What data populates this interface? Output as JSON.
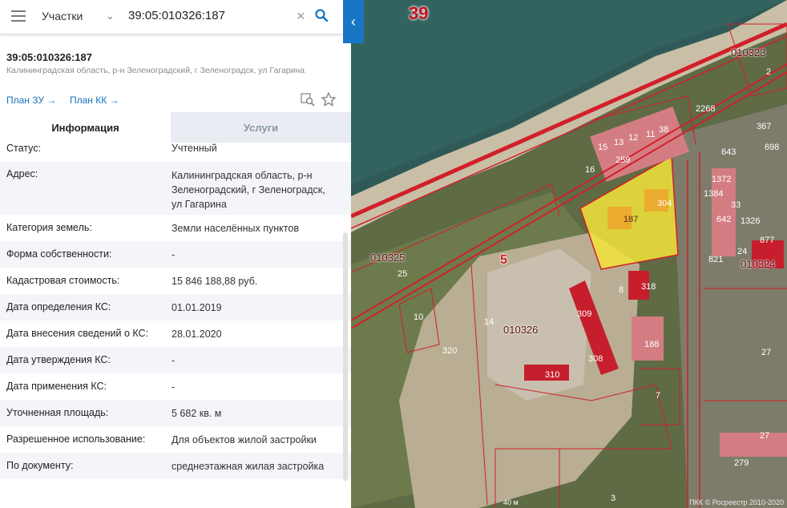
{
  "search": {
    "type_label": "Участки",
    "query": "39:05:010326:187"
  },
  "card": {
    "cadastral_number": "39:05:010326:187",
    "address_short": "Калининградская область, р-н Зеленоградский, г Зеленоградск, ул Гагарина",
    "plan_zu": "План ЗУ →",
    "plan_kk": "План КК →"
  },
  "tabs": {
    "info": "Информация",
    "services": "Услуги"
  },
  "rows": [
    {
      "label": "Статус:",
      "value": "Учтенный"
    },
    {
      "label": "Адрес:",
      "value": "Калининградская область, р-н Зеленоградский, г Зеленоградск, ул Гагарина"
    },
    {
      "label": "Категория земель:",
      "value": "Земли населённых пунктов"
    },
    {
      "label": "Форма собственности:",
      "value": "-"
    },
    {
      "label": "Кадастровая стоимость:",
      "value": "15 846 188,88 руб."
    },
    {
      "label": "Дата определения КС:",
      "value": "01.01.2019"
    },
    {
      "label": "Дата внесения сведений о КС:",
      "value": "28.01.2020"
    },
    {
      "label": "Дата утверждения КС:",
      "value": "-"
    },
    {
      "label": "Дата применения КС:",
      "value": "-"
    },
    {
      "label": "Уточненная площадь:",
      "value": "5 682 кв. м"
    },
    {
      "label": "Разрешенное использование:",
      "value": "Для объектов жилой застройки"
    },
    {
      "label": "По документу:",
      "value": "среднеэтажная жилая застройка"
    }
  ],
  "map": {
    "region": "39",
    "quarters": [
      "010323",
      "010325",
      "010326",
      "010324"
    ],
    "district": "5",
    "highlight_parcel": "187",
    "parcel_labels": [
      "304",
      "2268",
      "38",
      "11",
      "12",
      "13",
      "15",
      "259",
      "16",
      "643",
      "698",
      "367",
      "1372",
      "1384",
      "33",
      "642",
      "1326",
      "821",
      "24",
      "877",
      "25",
      "10",
      "14",
      "320",
      "309",
      "308",
      "310",
      "8",
      "318",
      "188",
      "7",
      "27",
      "27",
      "279",
      "3",
      "2"
    ],
    "scale": "40 м",
    "copyright": "ПКК © Росреестр 2010-2020"
  },
  "colors": {
    "accent": "#1976c4",
    "parcel_border": "#d21f2a",
    "highlight": "#f3e43a"
  }
}
